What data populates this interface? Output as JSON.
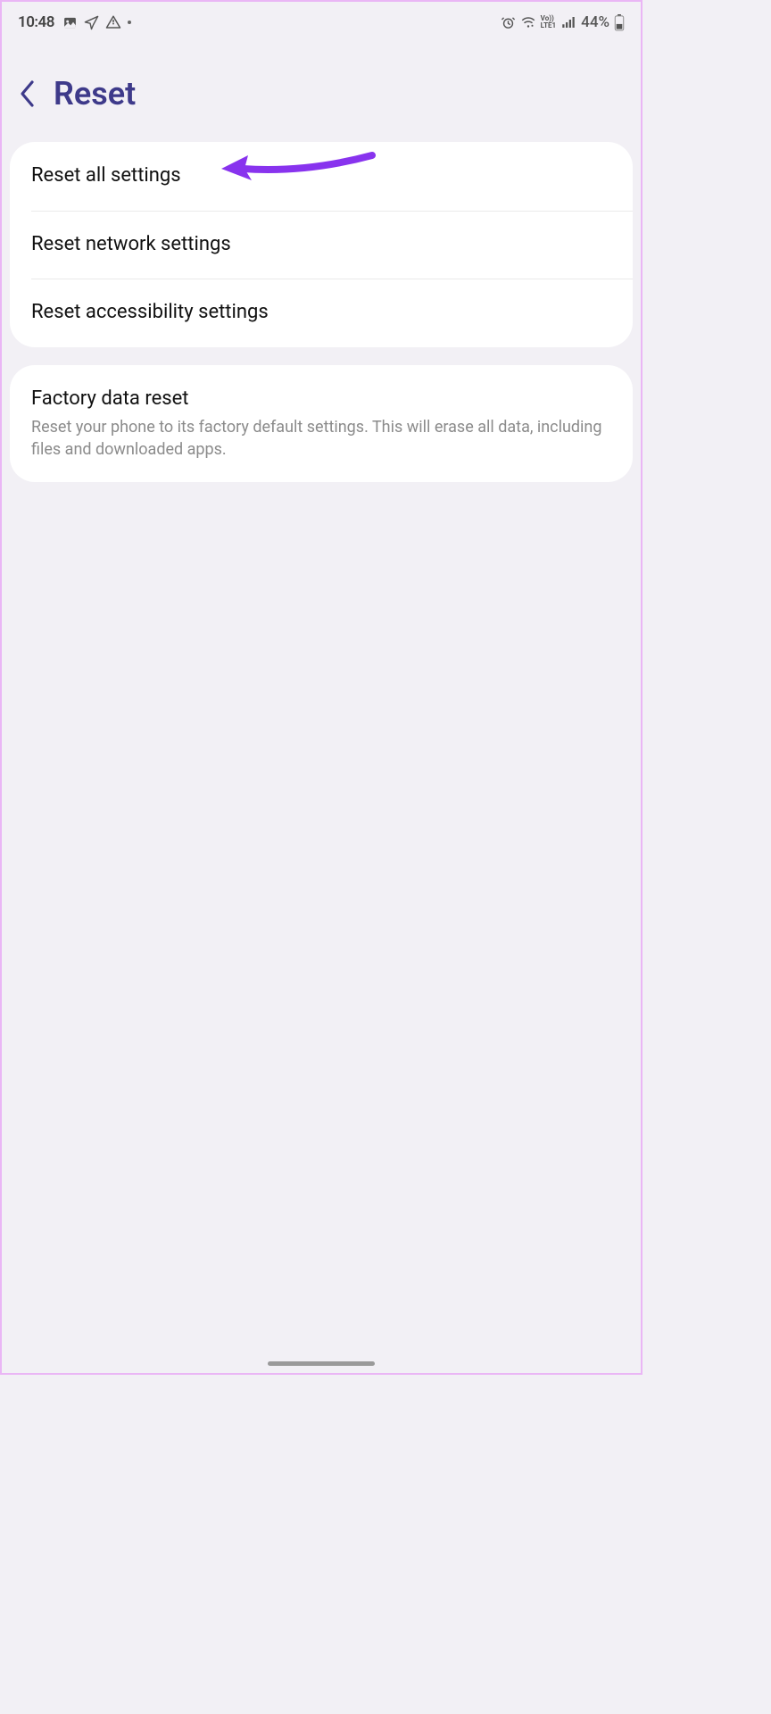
{
  "status_bar": {
    "time": "10:48",
    "battery_text": "44%"
  },
  "header": {
    "title": "Reset"
  },
  "group1": {
    "items": [
      {
        "label": "Reset all settings"
      },
      {
        "label": "Reset network settings"
      },
      {
        "label": "Reset accessibility settings"
      }
    ]
  },
  "group2": {
    "items": [
      {
        "label": "Factory data reset",
        "desc": "Reset your phone to its factory default settings. This will erase all data, including files and downloaded apps."
      }
    ]
  },
  "annotation": {
    "arrow_color": "#8833ee"
  }
}
